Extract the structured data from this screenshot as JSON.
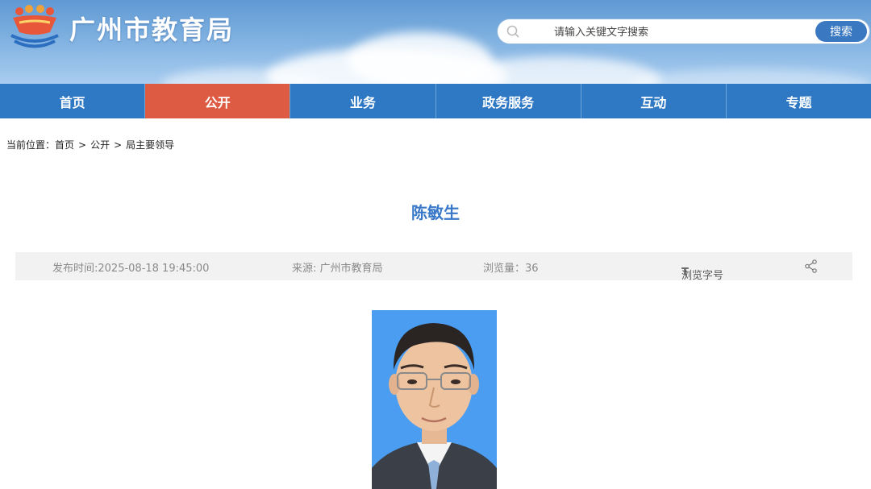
{
  "header": {
    "site_title": "广州市教育局",
    "search": {
      "placeholder": "请输入关键文字搜索",
      "button_label": "搜索"
    }
  },
  "nav": {
    "items": [
      {
        "label": "首页"
      },
      {
        "label": "公开",
        "active": true
      },
      {
        "label": "业务"
      },
      {
        "label": "政务服务"
      },
      {
        "label": "互动"
      },
      {
        "label": "专题"
      }
    ]
  },
  "breadcrumb": {
    "prefix": "当前位置：",
    "items": [
      "首页",
      "公开",
      "局主要领导"
    ],
    "separator": ">"
  },
  "article": {
    "title": "陈敏生",
    "meta": {
      "publish_time": "发布时间:2025-08-18 19:45:00",
      "source": "来源: 广州市教育局",
      "views": "浏览量：36",
      "font_icon": "T",
      "font_size_label": "浏览字号"
    }
  },
  "colors": {
    "nav_bg": "#2f78c4",
    "nav_active": "#dd5a43",
    "title_blue": "#3a78c8",
    "search_button": "#3a78c2",
    "portrait_bg": "#4a9df0"
  }
}
